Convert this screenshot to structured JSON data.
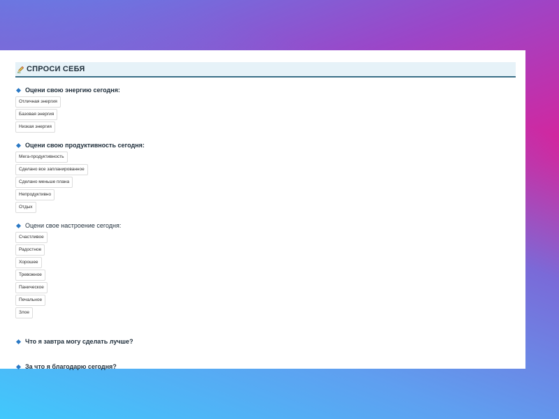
{
  "header": {
    "title": "СПРОСИ СЕБЯ",
    "icon": "pencil-icon"
  },
  "questions": [
    {
      "label": "Оцени свою энергию сегодня:",
      "options": [
        "Отличная энергия",
        "Базовая энергия",
        "Низкая энергия"
      ]
    },
    {
      "label": "Оцени свою продуктивность сегодня:",
      "options": [
        "Мега-продуктивность",
        "Сделано все запланированное",
        "Сделано меньше плана",
        "Непродуктивно",
        "Отдых"
      ]
    },
    {
      "label": "Оцени свое настроение сегодня:",
      "options": [
        "Счастливое",
        "Радостное",
        "Хорошее",
        "Тревожное",
        "Паническое",
        "Печальное",
        "Злое"
      ]
    }
  ],
  "open_questions": [
    "Что я завтра могу сделать лучше?",
    "За что я благодарю сегодня?"
  ],
  "colors": {
    "accent": "#2a78c4",
    "header_bg": "#e6f2f8",
    "header_border": "#3a6f86"
  }
}
